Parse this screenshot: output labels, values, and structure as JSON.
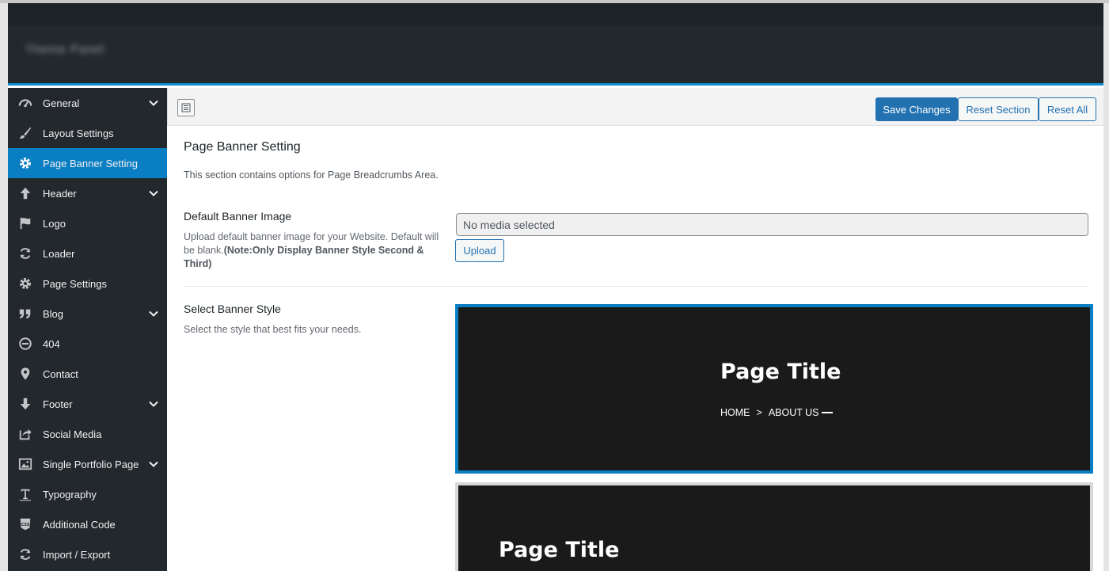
{
  "sidebar": {
    "items": [
      {
        "label": "General",
        "icon": "dashboard-icon",
        "chevron": true
      },
      {
        "label": "Layout Settings",
        "icon": "brush-icon",
        "chevron": false
      },
      {
        "label": "Page Banner Setting",
        "icon": "gear-icon",
        "chevron": false,
        "active": true
      },
      {
        "label": "Header",
        "icon": "arrow-up-icon",
        "chevron": true
      },
      {
        "label": "Logo",
        "icon": "flag-icon",
        "chevron": false
      },
      {
        "label": "Loader",
        "icon": "refresh-icon",
        "chevron": false
      },
      {
        "label": "Page Settings",
        "icon": "gear-icon",
        "chevron": false
      },
      {
        "label": "Blog",
        "icon": "quote-icon",
        "chevron": true
      },
      {
        "label": "404",
        "icon": "minus-circle-icon",
        "chevron": false
      },
      {
        "label": "Contact",
        "icon": "location-pin-icon",
        "chevron": false
      },
      {
        "label": "Footer",
        "icon": "arrow-down-icon",
        "chevron": true
      },
      {
        "label": "Social Media",
        "icon": "share-icon",
        "chevron": false
      },
      {
        "label": "Single Portfolio Page",
        "icon": "image-icon",
        "chevron": true
      },
      {
        "label": "Typography",
        "icon": "text-icon",
        "chevron": false
      },
      {
        "label": "Additional Code",
        "icon": "css-icon",
        "chevron": false
      },
      {
        "label": "Import / Export",
        "icon": "refresh-icon",
        "chevron": false
      }
    ]
  },
  "toolbar": {
    "save_label": "Save Changes",
    "reset_section_label": "Reset Section",
    "reset_all_label": "Reset All"
  },
  "section": {
    "title": "Page Banner Setting",
    "description": "This section contains options for Page Breadcrumbs Area."
  },
  "banner_image": {
    "title": "Default Banner Image",
    "description": "Upload default banner image for your Website. Default will be blank.",
    "note": "(Note:Only Display Banner Style Second & Third)",
    "placeholder": "No media selected",
    "upload_label": "Upload"
  },
  "banner_style": {
    "title": "Select Banner Style",
    "description": "Select the style that best fits your needs.",
    "options": [
      {
        "page_title": "Page Title",
        "crumb_home": "HOME",
        "crumb_sep": ">",
        "crumb_current": "ABOUT US"
      },
      {
        "page_title": "Page Title"
      }
    ]
  },
  "colors": {
    "accent": "#0a7ec2",
    "primary_button": "#2271b1",
    "sidebar_bg": "#23282d",
    "banner_bg": "#1a1a1a"
  }
}
